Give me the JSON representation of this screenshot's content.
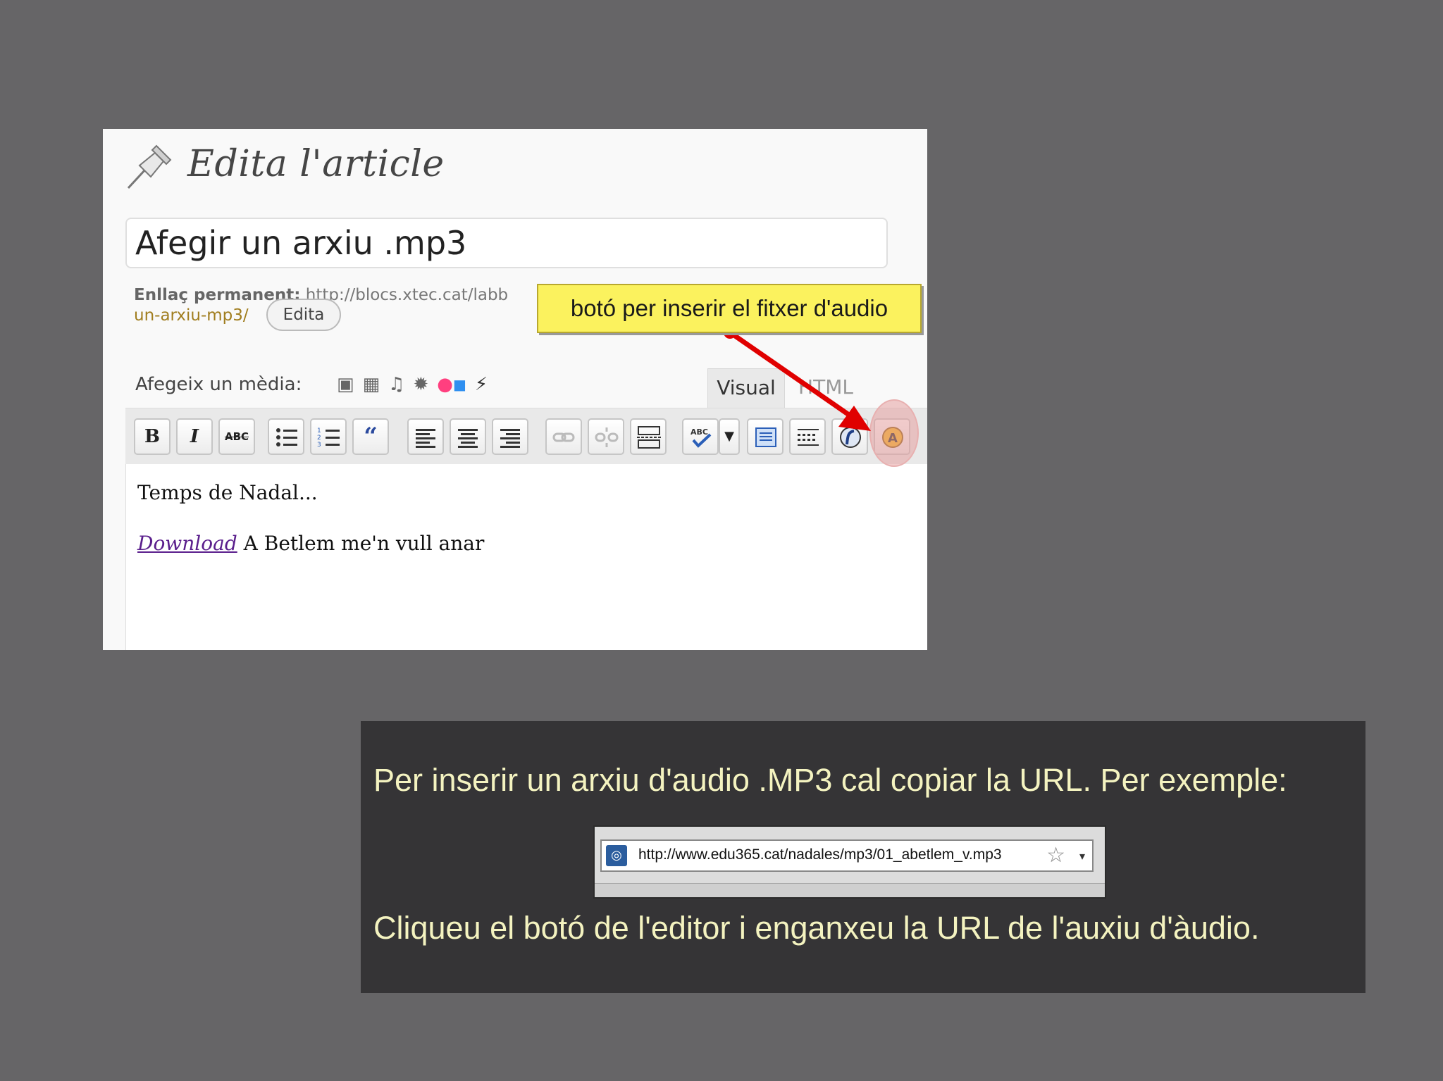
{
  "editor": {
    "page_title": "Edita l'article",
    "post_title": "Afegir un arxiu .mp3",
    "permalink": {
      "label": "Enllaç permanent:",
      "url_start": "http://blocs.xtec.cat/labb",
      "slug_end": "un-arxiu-mp3/",
      "edit_button": "Edita"
    },
    "media_label": "Afegeix un mèdia:",
    "media_icons": [
      "image-icon",
      "gallery-icon",
      "music-icon",
      "burst-icon",
      "flickr-icon",
      "magic-wand-icon"
    ],
    "tabs": {
      "visual": "Visual",
      "html": "HTML"
    },
    "toolbar": {
      "bold": "B",
      "italic": "I",
      "strike": "ABC",
      "quote": "“"
    },
    "content": {
      "line1": "Temps de Nadal...",
      "link_text": "Download",
      "line2_rest": " A Betlem me'n vull anar"
    }
  },
  "callout": {
    "text": "botó per inserir el fitxer d'audio",
    "color": "#fbf25e",
    "arrow_color": "#e00000"
  },
  "info": {
    "text1": "Per inserir un arxiu d'audio .MP3 cal copiar la URL. Per exemple:",
    "url": "http://www.edu365.cat/nadales/mp3/01_abetlem_v.mp3",
    "text2": "Cliqueu el botó de l'editor i enganxeu la URL de l'auxiu d'àudio."
  }
}
